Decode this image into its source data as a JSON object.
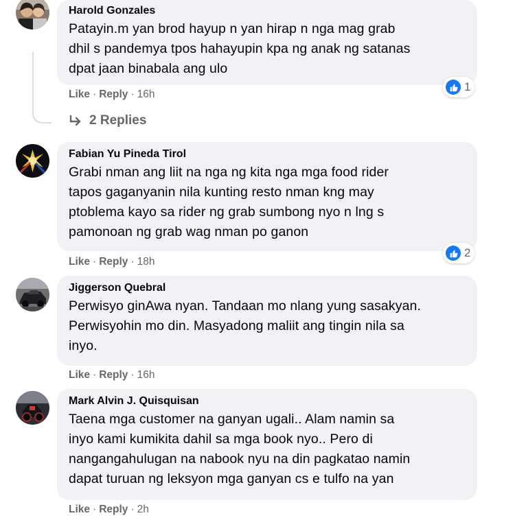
{
  "comments": [
    {
      "author": "Harold Gonzales",
      "text": "Patayin.m yan brod hayup n yan hirap n nga mag grab\ndhil s pandemya tpos hahayupin kpa ng anak ng satanas\ndpat jaan binabala ang ulo",
      "like": "Like",
      "reply": "Reply",
      "time": "16h",
      "reactions": "1",
      "replies_label": "2 Replies"
    },
    {
      "author": "Fabian Yu Pineda Tirol",
      "text": "Grabi nman ang liit na nga ng kita nga mga food rider\ntapos gaganyanin nila kunting resto nman kng may\nptoblema kayo sa rider ng grab sumbong nyo n lng s\npamonoan ng grab wag nman po ganon",
      "like": "Like",
      "reply": "Reply",
      "time": "18h",
      "reactions": "2"
    },
    {
      "author": "Jiggerson Quebral",
      "text": "Perwisyo ginAwa nyan. Tandaan mo nlang yung sasakyan.\nPerwisyohin mo din. Masyadong maliit ang tingin nila sa\ninyo.",
      "like": "Like",
      "reply": "Reply",
      "time": "16h"
    },
    {
      "author": "Mark Alvin J. Quisquisan",
      "text": "Taena mga customer na ganyan ugali.. Alam namin sa\ninyo kami kumikita dahil sa mga book nyo.. Pero di\nnangangahulugan na nabook nyu na din pagkatao namin\ndapat turuan ng leksyon mga ganyan cs e tulfo na yan",
      "like": "Like",
      "reply": "Reply",
      "time": "2h"
    }
  ],
  "colors": {
    "bubble": "#f0f2f5",
    "meta": "#65676b",
    "like_blue": "#1877f2"
  }
}
